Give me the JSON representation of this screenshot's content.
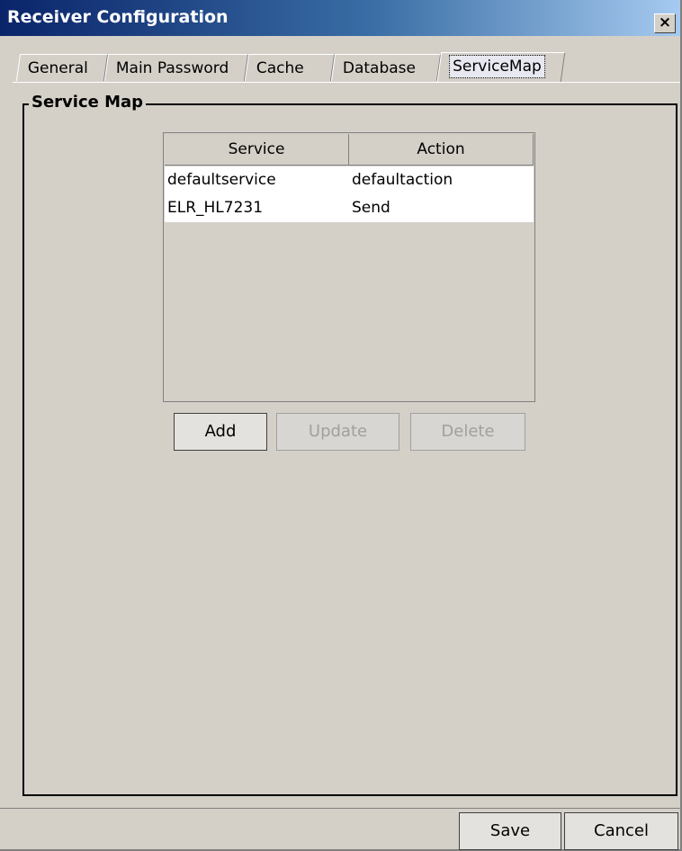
{
  "window": {
    "title": "Receiver Configuration",
    "close_label": "×"
  },
  "tabs": [
    "General",
    "Main Password",
    "Cache",
    "Database",
    "ServiceMap"
  ],
  "active_tab": "ServiceMap",
  "group": {
    "label": "Service Map"
  },
  "table": {
    "columns": [
      "Service",
      "Action"
    ],
    "rows": [
      [
        "defaultservice",
        "defaultaction"
      ],
      [
        "ELR_HL7231",
        "Send"
      ]
    ]
  },
  "buttons": {
    "add": "Add",
    "update": "Update",
    "delete": "Delete"
  },
  "footer": {
    "save": "Save",
    "cancel": "Cancel"
  }
}
